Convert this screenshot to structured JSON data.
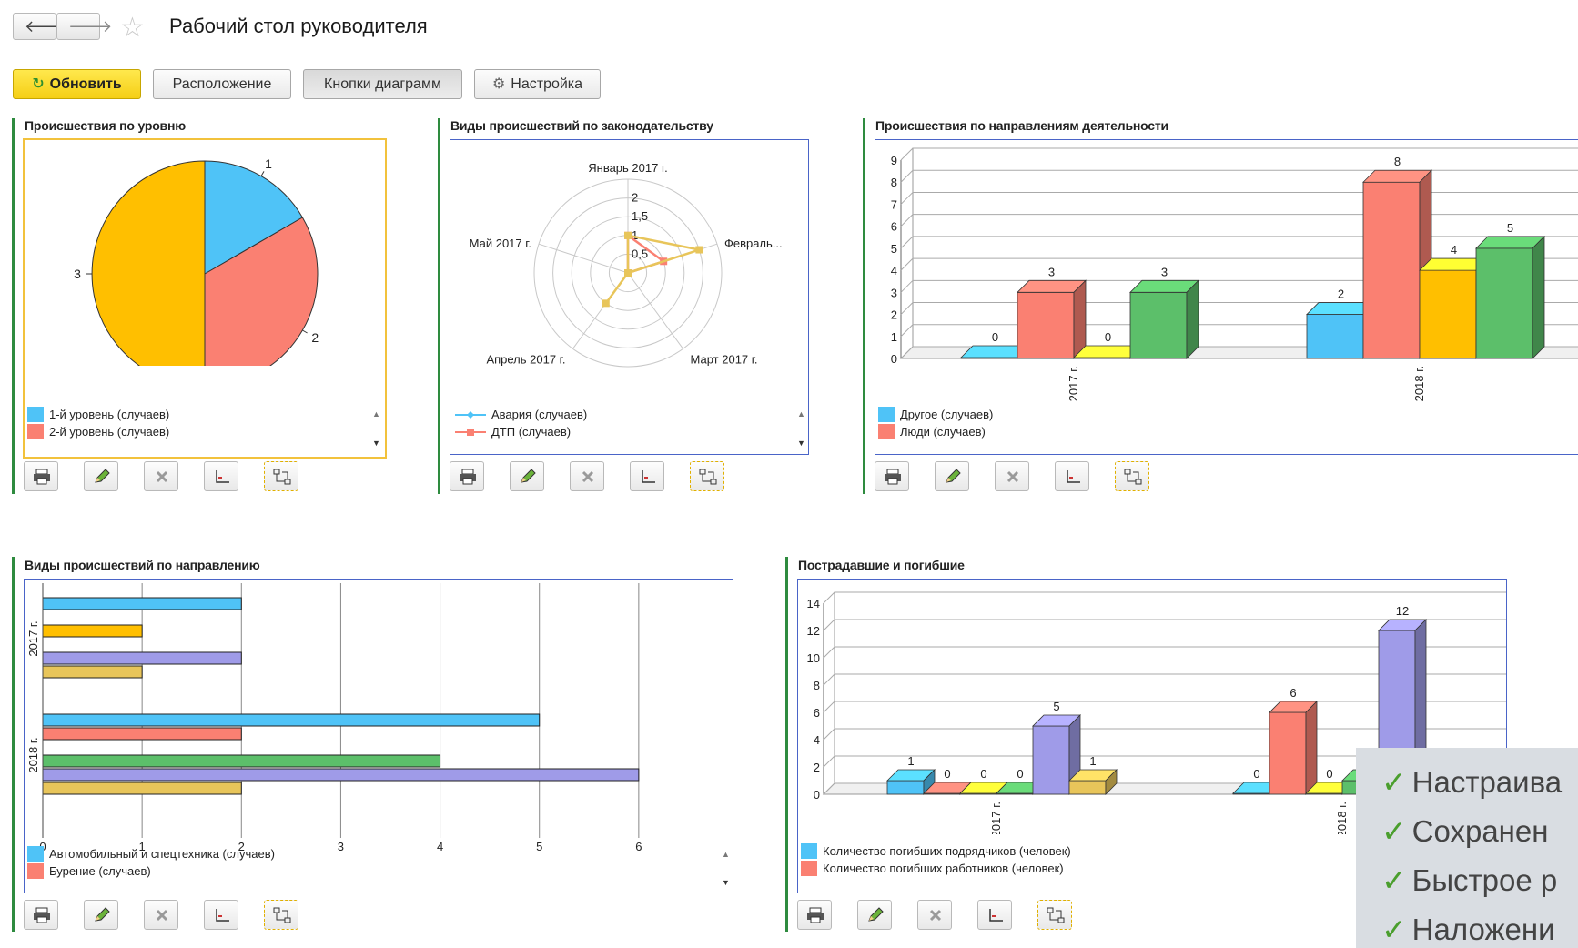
{
  "window": {
    "title": "Рабочий стол руководителя",
    "back_icon": "arrow-left-icon",
    "forward_icon": "arrow-right-icon",
    "star_icon": "star-icon"
  },
  "toolbar": {
    "refresh": "Обновить",
    "layout": "Расположение",
    "chart_buttons": "Кнопки диаграмм",
    "settings": "Настройка"
  },
  "panels": {
    "p1": {
      "title": "Происшествия по уровню",
      "legend": [
        "1-й уровень (случаев)",
        "2-й уровень (случаев)"
      ]
    },
    "p2": {
      "title": "Виды происшествий по законодательству",
      "legend": [
        "Авария (случаев)",
        "ДТП (случаев)"
      ]
    },
    "p3": {
      "title": "Происшествия по направлениям деятельности",
      "legend": [
        "Другое (случаев)",
        "Люди (случаев)"
      ]
    },
    "p4": {
      "title": "Виды происшествий по направлению",
      "legend": [
        "Автомобильный и спецтехника (случаев)",
        "Бурение (случаев)"
      ]
    },
    "p5": {
      "title": "Пострадавшие и погибшие",
      "legend": [
        "Количество погибших подрядчиков (человек)",
        "Количество погибших работников (человек)"
      ]
    }
  },
  "icons": [
    "printer-icon",
    "pencil-icon",
    "delete-icon",
    "axes-icon",
    "swap-icon"
  ],
  "callout": {
    "lines": [
      "Настраива",
      "Сохранен",
      "Быстрое р",
      "Наложени"
    ]
  },
  "colors": {
    "cyan": "#4fc3f7",
    "salmon": "#fa8072",
    "yellow": "#ffff33",
    "green": "#5cbf6a",
    "purple": "#9f9be8",
    "orange": "#ffbf00",
    "tan": "#e8c55a"
  },
  "chart_data": [
    {
      "type": "pie",
      "title": "Происшествия по уровню",
      "labels": [
        "1-й уровень (случаев)",
        "2-й уровень (случаев)",
        ""
      ],
      "values": [
        1,
        2,
        3
      ],
      "colors": [
        "#4fc3f7",
        "#fa8072",
        "#ffbf00"
      ]
    },
    {
      "type": "radar",
      "title": "Виды происшествий по законодательству",
      "categories": [
        "Январь 2017 г.",
        "Февраль...",
        "Март 2017 г.",
        "Апрель 2017 г.",
        "Май 2017 г."
      ],
      "rticks": [
        "0,5",
        "1",
        "1,5",
        "2"
      ],
      "rmax": 2.5,
      "series": [
        {
          "name": "Авария (случаев)",
          "values": [
            1,
            2,
            0,
            1,
            0
          ]
        },
        {
          "name": "ДТП (случаев)",
          "values": [
            1,
            1,
            0,
            0,
            0
          ]
        }
      ]
    },
    {
      "type": "bar",
      "title": "Происшествия по направлениям деятельности",
      "categories": [
        "2017 г.",
        "2018 г."
      ],
      "ylim": [
        0,
        9
      ],
      "yticks": [
        0,
        1,
        2,
        3,
        4,
        5,
        6,
        7,
        8,
        9
      ],
      "series": [
        {
          "name": "Другое (случаев)",
          "values": [
            0,
            2
          ]
        },
        {
          "name": "Люди (случаев)",
          "values": [
            3,
            8
          ]
        },
        {
          "name": "",
          "values": [
            0,
            4
          ]
        },
        {
          "name": "",
          "values": [
            3,
            5
          ]
        }
      ]
    },
    {
      "type": "bar",
      "orientation": "horizontal",
      "title": "Виды происшествий по направлению",
      "categories": [
        "2017 г.",
        "2018 г."
      ],
      "xlim": [
        0,
        7
      ],
      "xticks": [
        0,
        1,
        2,
        3,
        4,
        5,
        6,
        7
      ],
      "series": [
        {
          "name": "Автомобильный и спецтехника (случаев)",
          "values": [
            2,
            5
          ]
        },
        {
          "name": "Бурение (случаев)",
          "values": [
            0,
            2
          ]
        },
        {
          "name": "",
          "values": [
            1,
            0
          ]
        },
        {
          "name": "",
          "values": [
            0,
            4
          ]
        },
        {
          "name": "",
          "values": [
            2,
            6
          ]
        },
        {
          "name": "",
          "values": [
            1,
            2
          ]
        }
      ]
    },
    {
      "type": "bar",
      "title": "Пострадавшие и погибшие",
      "categories": [
        "2017 г.",
        "2018 г."
      ],
      "ylim": [
        0,
        14
      ],
      "yticks": [
        0,
        2,
        4,
        6,
        8,
        10,
        12,
        14
      ],
      "series": [
        {
          "name": "Количество погибших подрядчиков (человек)",
          "values": [
            1,
            0
          ]
        },
        {
          "name": "Количество погибших работников (человек)",
          "values": [
            0,
            6
          ]
        },
        {
          "name": "",
          "values": [
            0,
            0
          ]
        },
        {
          "name": "",
          "values": [
            0,
            1
          ]
        },
        {
          "name": "",
          "values": [
            5,
            12
          ]
        },
        {
          "name": "",
          "values": [
            1,
            null
          ]
        }
      ]
    }
  ]
}
